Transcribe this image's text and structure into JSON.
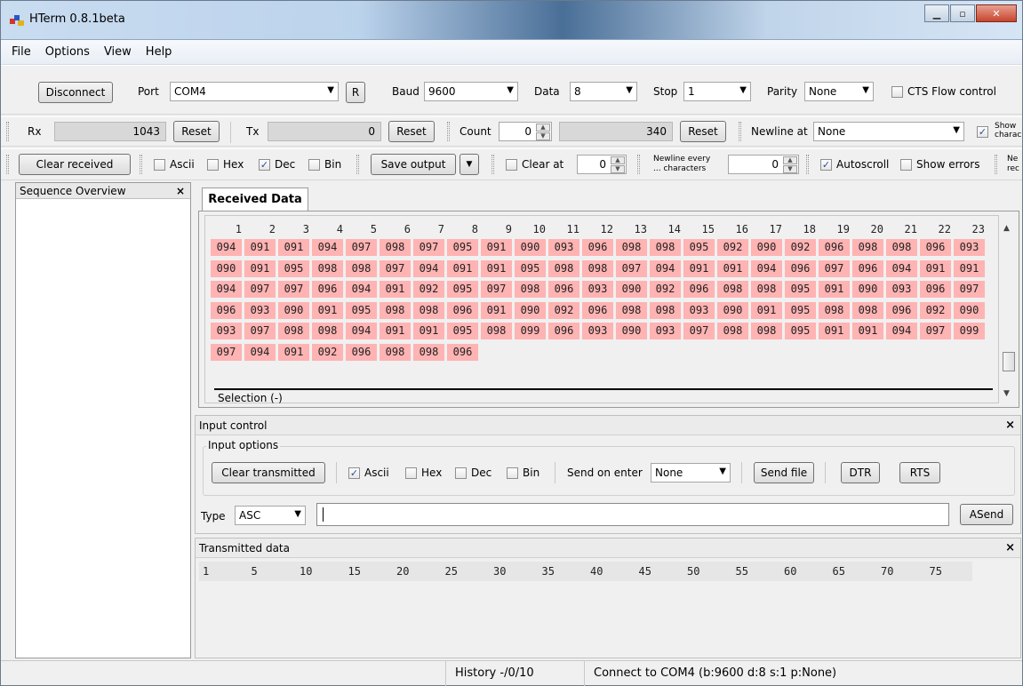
{
  "window": {
    "title": "HTerm 0.8.1beta"
  },
  "menu": [
    "File",
    "Options",
    "View",
    "Help"
  ],
  "connection": {
    "disconnect_label": "Disconnect",
    "port_label": "Port",
    "port_value": "COM4",
    "r_label": "R",
    "baud_label": "Baud",
    "baud_value": "9600",
    "data_label": "Data",
    "data_value": "8",
    "stop_label": "Stop",
    "stop_value": "1",
    "parity_label": "Parity",
    "parity_value": "None",
    "cts_label": "CTS Flow control"
  },
  "counters": {
    "rx_label": "Rx",
    "rx_value": "1043",
    "rx_reset": "Reset",
    "tx_label": "Tx",
    "tx_value": "0",
    "tx_reset": "Reset",
    "count_label": "Count",
    "count_value": "0",
    "count_total": "340",
    "count_reset": "Reset",
    "newline_label": "Newline at",
    "newline_value": "None",
    "show_label_1": "Show",
    "show_label_2": "charac"
  },
  "display": {
    "clear_received": "Clear received",
    "ascii": "Ascii",
    "hex": "Hex",
    "dec": "Dec",
    "bin": "Bin",
    "save_output": "Save output",
    "clear_at": "Clear at",
    "clear_at_value": "0",
    "newline_every_1": "Newline every",
    "newline_every_2": "... characters",
    "newline_every_value": "0",
    "autoscroll": "Autoscroll",
    "show_errors": "Show errors",
    "ne_1": "Ne",
    "ne_2": "rec"
  },
  "sequence": {
    "title": "Sequence Overview",
    "close": "×"
  },
  "received": {
    "tab": "Received Data",
    "columns": [
      "1",
      "2",
      "3",
      "4",
      "5",
      "6",
      "7",
      "8",
      "9",
      "10",
      "11",
      "12",
      "13",
      "14",
      "15",
      "16",
      "17",
      "18",
      "19",
      "20",
      "21",
      "22",
      "23"
    ],
    "rows": [
      [
        "094",
        "091",
        "091",
        "094",
        "097",
        "098",
        "097",
        "095",
        "091",
        "090",
        "093",
        "096",
        "098",
        "098",
        "095",
        "092",
        "090",
        "092",
        "096",
        "098",
        "098",
        "096",
        "093"
      ],
      [
        "090",
        "091",
        "095",
        "098",
        "098",
        "097",
        "094",
        "091",
        "091",
        "095",
        "098",
        "098",
        "097",
        "094",
        "091",
        "091",
        "094",
        "096",
        "097",
        "096",
        "094",
        "091",
        "091"
      ],
      [
        "094",
        "097",
        "097",
        "096",
        "094",
        "091",
        "092",
        "095",
        "097",
        "098",
        "096",
        "093",
        "090",
        "092",
        "096",
        "098",
        "098",
        "095",
        "091",
        "090",
        "093",
        "096",
        "097"
      ],
      [
        "096",
        "093",
        "090",
        "091",
        "095",
        "098",
        "098",
        "096",
        "091",
        "090",
        "092",
        "096",
        "098",
        "098",
        "093",
        "090",
        "091",
        "095",
        "098",
        "098",
        "096",
        "092",
        "090"
      ],
      [
        "093",
        "097",
        "098",
        "098",
        "094",
        "091",
        "091",
        "095",
        "098",
        "099",
        "096",
        "093",
        "090",
        "093",
        "097",
        "098",
        "098",
        "095",
        "091",
        "091",
        "094",
        "097",
        "099"
      ],
      [
        "097",
        "094",
        "091",
        "092",
        "096",
        "098",
        "098",
        "096"
      ]
    ],
    "selection": "Selection (-)"
  },
  "input": {
    "title": "Input control",
    "close": "×",
    "options_label": "Input options",
    "clear_transmitted": "Clear transmitted",
    "ascii": "Ascii",
    "hex": "Hex",
    "dec": "Dec",
    "bin": "Bin",
    "send_on_enter_label": "Send on enter",
    "send_on_enter_value": "None",
    "send_file": "Send file",
    "dtr": "DTR",
    "rts": "RTS",
    "type_label": "Type",
    "type_value": "ASC",
    "text_value": "",
    "asend": "ASend"
  },
  "transmitted": {
    "title": "Transmitted data",
    "close": "×",
    "columns": [
      "1",
      "5",
      "10",
      "15",
      "20",
      "25",
      "30",
      "35",
      "40",
      "45",
      "50",
      "55",
      "60",
      "65",
      "70",
      "75"
    ]
  },
  "status": {
    "history": "History -/0/10",
    "connection": "Connect to COM4 (b:9600 d:8 s:1 p:None)"
  },
  "colors": {
    "cell": "#ffb3b3"
  }
}
